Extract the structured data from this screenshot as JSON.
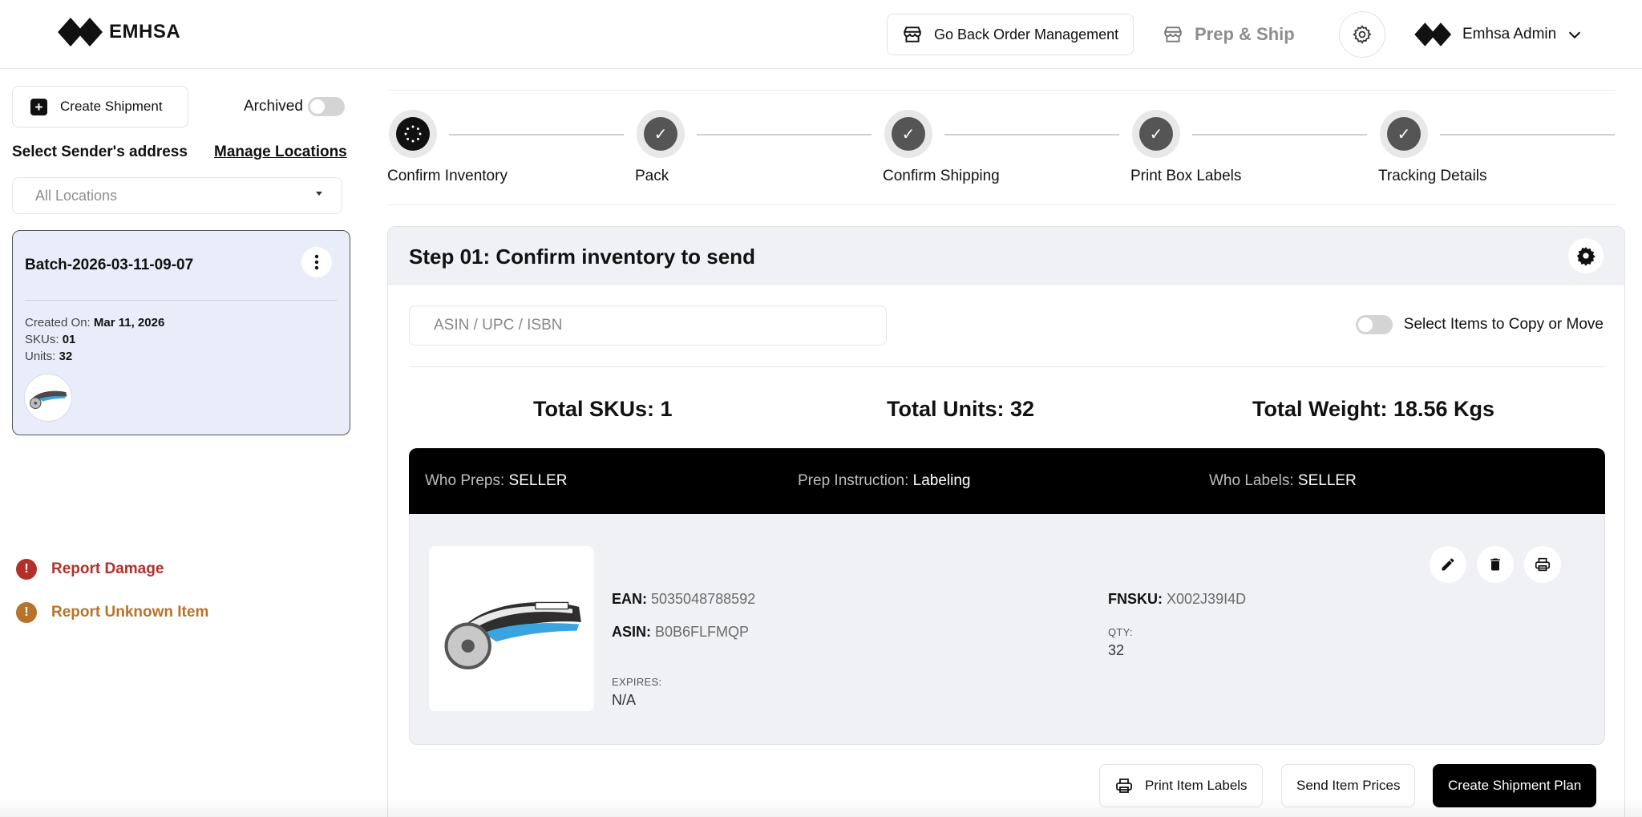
{
  "header": {
    "brand": "EMHSA",
    "go_back_label": "Go Back Order Management",
    "prep_ship_label": "Prep & Ship",
    "user_name": "Emhsa Admin"
  },
  "sidebar": {
    "create_label": "Create Shipment",
    "archived_label": "Archived",
    "sender_label": "Select Sender's address",
    "manage_label": "Manage Locations",
    "location_placeholder": "All Locations",
    "batch": {
      "title": "Batch-2026-03-11-09-07",
      "created_label": "Created On:",
      "created_value": "Mar 11, 2026",
      "skus_label": "SKUs:",
      "skus_value": "01",
      "units_label": "Units:",
      "units_value": "32"
    },
    "report_damage": "Report Damage",
    "report_unknown": "Report Unknown Item"
  },
  "steps": [
    {
      "label": "Confirm Inventory",
      "state": "active"
    },
    {
      "label": "Pack",
      "state": "pending"
    },
    {
      "label": "Confirm Shipping",
      "state": "pending"
    },
    {
      "label": "Print Box Labels",
      "state": "pending"
    },
    {
      "label": "Tracking Details",
      "state": "pending"
    }
  ],
  "panel": {
    "title": "Step 01: Confirm inventory to send",
    "search_placeholder": "ASIN / UPC / ISBN",
    "copy_move_label": "Select Items to Copy or Move",
    "total_skus": "Total SKUs: 1",
    "total_units": "Total Units: 32",
    "total_weight": "Total Weight: 18.56 Kgs"
  },
  "prep": {
    "who_preps_label": "Who Preps:",
    "who_preps_value": "SELLER",
    "instruction_label": "Prep Instruction:",
    "instruction_value": "Labeling",
    "who_labels_label": "Who Labels:",
    "who_labels_value": "SELLER"
  },
  "item": {
    "ean_label": "EAN:",
    "ean_value": "5035048788592",
    "asin_label": "ASIN:",
    "asin_value": "B0B6FLFMQP",
    "fnsku_label": "FNSKU:",
    "fnsku_value": "X002J39I4D",
    "qty_label": "QTY:",
    "qty_value": "32",
    "expires_label": "EXPIRES:",
    "expires_value": "N/A"
  },
  "footer": {
    "print_labels": "Print Item Labels",
    "send_prices": "Send Item Prices",
    "create_plan": "Create Shipment Plan"
  },
  "colors": {
    "damage": "#b3302a",
    "unknown": "#b8732a",
    "batch_bg": "#e8edf9",
    "prep_bar": "#000000"
  }
}
